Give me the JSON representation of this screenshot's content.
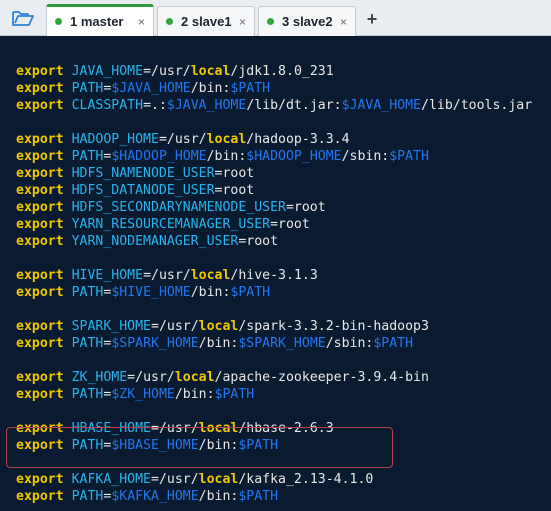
{
  "tabs": [
    {
      "label": "1 master",
      "active": true,
      "close": "×"
    },
    {
      "label": "2 slave1",
      "active": false,
      "close": "×"
    },
    {
      "label": "3 slave2",
      "active": false,
      "close": "×"
    }
  ],
  "new_tab_label": "+",
  "colors": {
    "background": "#0a1a30",
    "keyword": "#f0c800",
    "variable": "#25b4ee",
    "reference": "#2277ee",
    "text": "#e8e8e8",
    "highlight_border": "#b8404a",
    "tab_accent": "#2f9a3a"
  },
  "icons": {
    "folder": "folder-open-icon",
    "close": "close-icon",
    "plus": "plus-icon"
  },
  "lines": [
    {
      "row": 1,
      "parts": [
        [
          "kw",
          "export"
        ],
        [
          "sp",
          " "
        ],
        [
          "var",
          "JAVA_HOME"
        ],
        [
          "eq",
          "="
        ],
        [
          "path",
          "/usr/"
        ],
        [
          "hl",
          "local"
        ],
        [
          "path",
          "/jdk1.8.0_231"
        ]
      ]
    },
    {
      "row": 2,
      "parts": [
        [
          "kw",
          "export"
        ],
        [
          "sp",
          " "
        ],
        [
          "var",
          "PATH"
        ],
        [
          "eq",
          "="
        ],
        [
          "ref",
          "$JAVA_HOME"
        ],
        [
          "path",
          "/bin:"
        ],
        [
          "ref",
          "$PATH"
        ]
      ]
    },
    {
      "row": 3,
      "parts": [
        [
          "kw",
          "export"
        ],
        [
          "sp",
          " "
        ],
        [
          "var",
          "CLASSPATH"
        ],
        [
          "eq",
          "="
        ],
        [
          "path",
          ".:"
        ],
        [
          "ref",
          "$JAVA_HOME"
        ],
        [
          "path",
          "/lib/dt.jar:"
        ],
        [
          "ref",
          "$JAVA_HOME"
        ],
        [
          "path",
          "/lib/tools.jar"
        ]
      ]
    },
    {
      "row": 5,
      "parts": [
        [
          "kw",
          "export"
        ],
        [
          "sp",
          " "
        ],
        [
          "var",
          "HADOOP_HOME"
        ],
        [
          "eq",
          "="
        ],
        [
          "path",
          "/usr/"
        ],
        [
          "hl",
          "local"
        ],
        [
          "path",
          "/hadoop-3.3.4"
        ]
      ]
    },
    {
      "row": 6,
      "parts": [
        [
          "kw",
          "export"
        ],
        [
          "sp",
          " "
        ],
        [
          "var",
          "PATH"
        ],
        [
          "eq",
          "="
        ],
        [
          "ref",
          "$HADOOP_HOME"
        ],
        [
          "path",
          "/bin:"
        ],
        [
          "ref",
          "$HADOOP_HOME"
        ],
        [
          "path",
          "/sbin:"
        ],
        [
          "ref",
          "$PATH"
        ]
      ]
    },
    {
      "row": 7,
      "parts": [
        [
          "kw",
          "export"
        ],
        [
          "sp",
          " "
        ],
        [
          "var",
          "HDFS_NAMENODE_USER"
        ],
        [
          "eq",
          "="
        ],
        [
          "path",
          "root"
        ]
      ]
    },
    {
      "row": 8,
      "parts": [
        [
          "kw",
          "export"
        ],
        [
          "sp",
          " "
        ],
        [
          "var",
          "HDFS_DATANODE_USER"
        ],
        [
          "eq",
          "="
        ],
        [
          "path",
          "root"
        ]
      ]
    },
    {
      "row": 9,
      "parts": [
        [
          "kw",
          "export"
        ],
        [
          "sp",
          " "
        ],
        [
          "var",
          "HDFS_SECONDARYNAMENODE_USER"
        ],
        [
          "eq",
          "="
        ],
        [
          "path",
          "root"
        ]
      ]
    },
    {
      "row": 10,
      "parts": [
        [
          "kw",
          "export"
        ],
        [
          "sp",
          " "
        ],
        [
          "var",
          "YARN_RESOURCEMANAGER_USER"
        ],
        [
          "eq",
          "="
        ],
        [
          "path",
          "root"
        ]
      ]
    },
    {
      "row": 11,
      "parts": [
        [
          "kw",
          "export"
        ],
        [
          "sp",
          " "
        ],
        [
          "var",
          "YARN_NODEMANAGER_USER"
        ],
        [
          "eq",
          "="
        ],
        [
          "path",
          "root"
        ]
      ]
    },
    {
      "row": 13,
      "parts": [
        [
          "kw",
          "export"
        ],
        [
          "sp",
          " "
        ],
        [
          "var",
          "HIVE_HOME"
        ],
        [
          "eq",
          "="
        ],
        [
          "path",
          "/usr/"
        ],
        [
          "hl",
          "local"
        ],
        [
          "path",
          "/hive-3.1.3"
        ]
      ]
    },
    {
      "row": 14,
      "parts": [
        [
          "kw",
          "export"
        ],
        [
          "sp",
          " "
        ],
        [
          "var",
          "PATH"
        ],
        [
          "eq",
          "="
        ],
        [
          "ref",
          "$HIVE_HOME"
        ],
        [
          "path",
          "/bin:"
        ],
        [
          "ref",
          "$PATH"
        ]
      ]
    },
    {
      "row": 16,
      "parts": [
        [
          "kw",
          "export"
        ],
        [
          "sp",
          " "
        ],
        [
          "var",
          "SPARK_HOME"
        ],
        [
          "eq",
          "="
        ],
        [
          "path",
          "/usr/"
        ],
        [
          "hl",
          "local"
        ],
        [
          "path",
          "/spark-3.3.2-bin-hadoop3"
        ]
      ]
    },
    {
      "row": 17,
      "parts": [
        [
          "kw",
          "export"
        ],
        [
          "sp",
          " "
        ],
        [
          "var",
          "PATH"
        ],
        [
          "eq",
          "="
        ],
        [
          "ref",
          "$SPARK_HOME"
        ],
        [
          "path",
          "/bin:"
        ],
        [
          "ref",
          "$SPARK_HOME"
        ],
        [
          "path",
          "/sbin:"
        ],
        [
          "ref",
          "$PATH"
        ]
      ]
    },
    {
      "row": 19,
      "parts": [
        [
          "kw",
          "export"
        ],
        [
          "sp",
          " "
        ],
        [
          "var",
          "ZK_HOME"
        ],
        [
          "eq",
          "="
        ],
        [
          "path",
          "/usr/"
        ],
        [
          "hl",
          "local"
        ],
        [
          "path",
          "/apache-zookeeper-3.9.4-bin"
        ]
      ]
    },
    {
      "row": 20,
      "parts": [
        [
          "kw",
          "export"
        ],
        [
          "sp",
          " "
        ],
        [
          "var",
          "PATH"
        ],
        [
          "eq",
          "="
        ],
        [
          "ref",
          "$ZK_HOME"
        ],
        [
          "path",
          "/bin:"
        ],
        [
          "ref",
          "$PATH"
        ]
      ]
    },
    {
      "row": 22,
      "parts": [
        [
          "kw",
          "export"
        ],
        [
          "sp",
          " "
        ],
        [
          "var",
          "HBASE_HOME"
        ],
        [
          "eq",
          "="
        ],
        [
          "path",
          "/usr/"
        ],
        [
          "hl",
          "local"
        ],
        [
          "path",
          "/hbase-2.6.3"
        ]
      ]
    },
    {
      "row": 23,
      "parts": [
        [
          "kw",
          "export"
        ],
        [
          "sp",
          " "
        ],
        [
          "var",
          "PATH"
        ],
        [
          "eq",
          "="
        ],
        [
          "ref",
          "$HBASE_HOME"
        ],
        [
          "path",
          "/bin:"
        ],
        [
          "ref",
          "$PATH"
        ]
      ]
    },
    {
      "row": 25,
      "parts": [
        [
          "kw",
          "export"
        ],
        [
          "sp",
          " "
        ],
        [
          "var",
          "KAFKA_HOME"
        ],
        [
          "eq",
          "="
        ],
        [
          "path",
          "/usr/"
        ],
        [
          "hl",
          "local"
        ],
        [
          "path",
          "/kafka_2.13-4.1.0"
        ]
      ]
    },
    {
      "row": 26,
      "parts": [
        [
          "kw",
          "export"
        ],
        [
          "sp",
          " "
        ],
        [
          "var",
          "PATH"
        ],
        [
          "eq",
          "="
        ],
        [
          "ref",
          "$KAFKA_HOME"
        ],
        [
          "path",
          "/bin:"
        ],
        [
          "ref",
          "$PATH"
        ]
      ]
    }
  ],
  "highlighted_rows": [
    25,
    26
  ]
}
